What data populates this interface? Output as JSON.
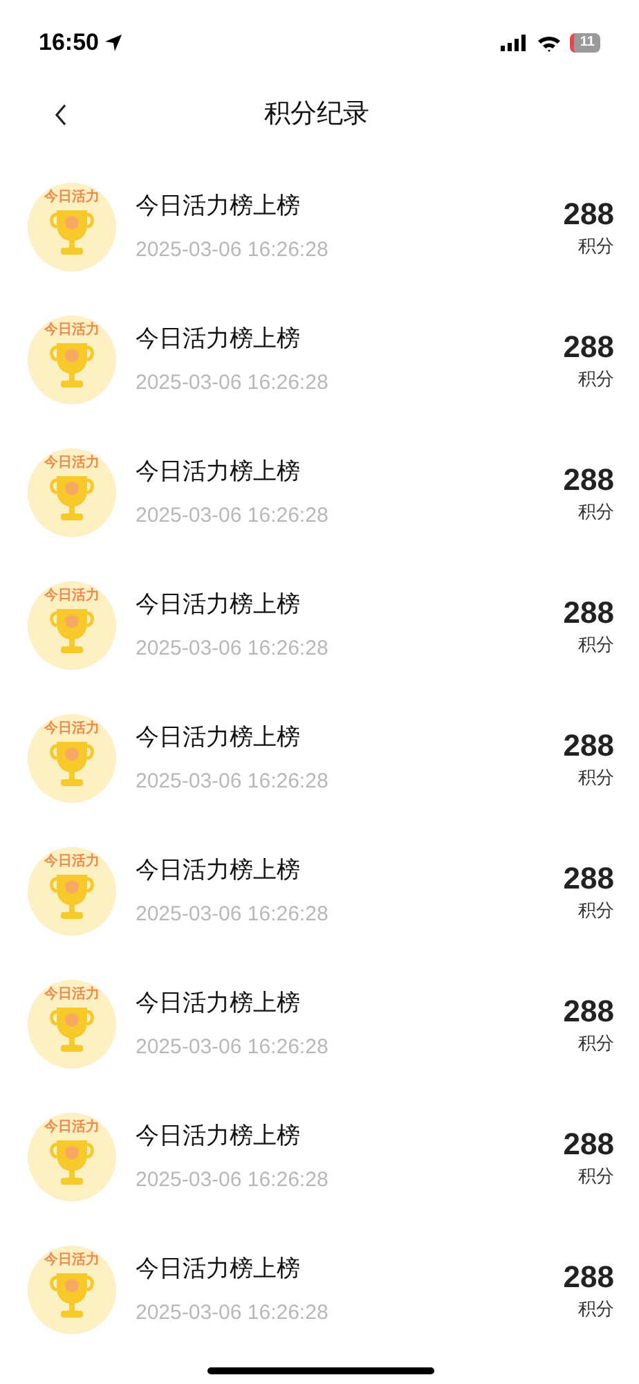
{
  "status_bar": {
    "time": "16:50",
    "battery": "11"
  },
  "header": {
    "title": "积分纪录"
  },
  "records": [
    {
      "badge": "今日活力",
      "title": "今日活力榜上榜",
      "time": "2025-03-06 16:26:28",
      "points": "288",
      "unit": "积分"
    },
    {
      "badge": "今日活力",
      "title": "今日活力榜上榜",
      "time": "2025-03-06 16:26:28",
      "points": "288",
      "unit": "积分"
    },
    {
      "badge": "今日活力",
      "title": "今日活力榜上榜",
      "time": "2025-03-06 16:26:28",
      "points": "288",
      "unit": "积分"
    },
    {
      "badge": "今日活力",
      "title": "今日活力榜上榜",
      "time": "2025-03-06 16:26:28",
      "points": "288",
      "unit": "积分"
    },
    {
      "badge": "今日活力",
      "title": "今日活力榜上榜",
      "time": "2025-03-06 16:26:28",
      "points": "288",
      "unit": "积分"
    },
    {
      "badge": "今日活力",
      "title": "今日活力榜上榜",
      "time": "2025-03-06 16:26:28",
      "points": "288",
      "unit": "积分"
    },
    {
      "badge": "今日活力",
      "title": "今日活力榜上榜",
      "time": "2025-03-06 16:26:28",
      "points": "288",
      "unit": "积分"
    },
    {
      "badge": "今日活力",
      "title": "今日活力榜上榜",
      "time": "2025-03-06 16:26:28",
      "points": "288",
      "unit": "积分"
    },
    {
      "badge": "今日活力",
      "title": "今日活力榜上榜",
      "time": "2025-03-06 16:26:28",
      "points": "288",
      "unit": "积分"
    }
  ]
}
